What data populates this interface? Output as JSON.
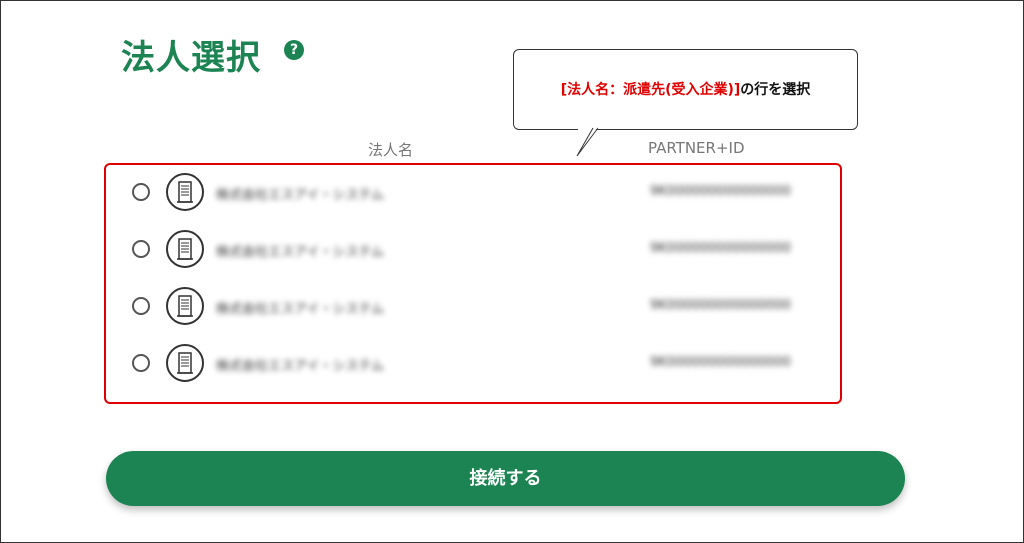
{
  "title": "法人選択",
  "help_icon": "question-circle-icon",
  "callout": {
    "highlight": "[法人名：派遣先(受入企業)]",
    "suffix": "の行を選択"
  },
  "columns": {
    "name": "法人名",
    "id": "PARTNER+ID"
  },
  "rows": [
    {
      "name": "株式会社エスアイ・システム",
      "id": "9K000000000000000"
    },
    {
      "name": "株式会社エスアイ・システム",
      "id": "9K000000000000000"
    },
    {
      "name": "株式会社エスアイ・システム",
      "id": "9K000000000000000"
    },
    {
      "name": "株式会社エスアイ・システム",
      "id": "9K000000000000000"
    }
  ],
  "row_icon": "building-icon",
  "connect_label": "接続する",
  "colors": {
    "primary": "#1b8452",
    "highlight": "#e00000"
  }
}
